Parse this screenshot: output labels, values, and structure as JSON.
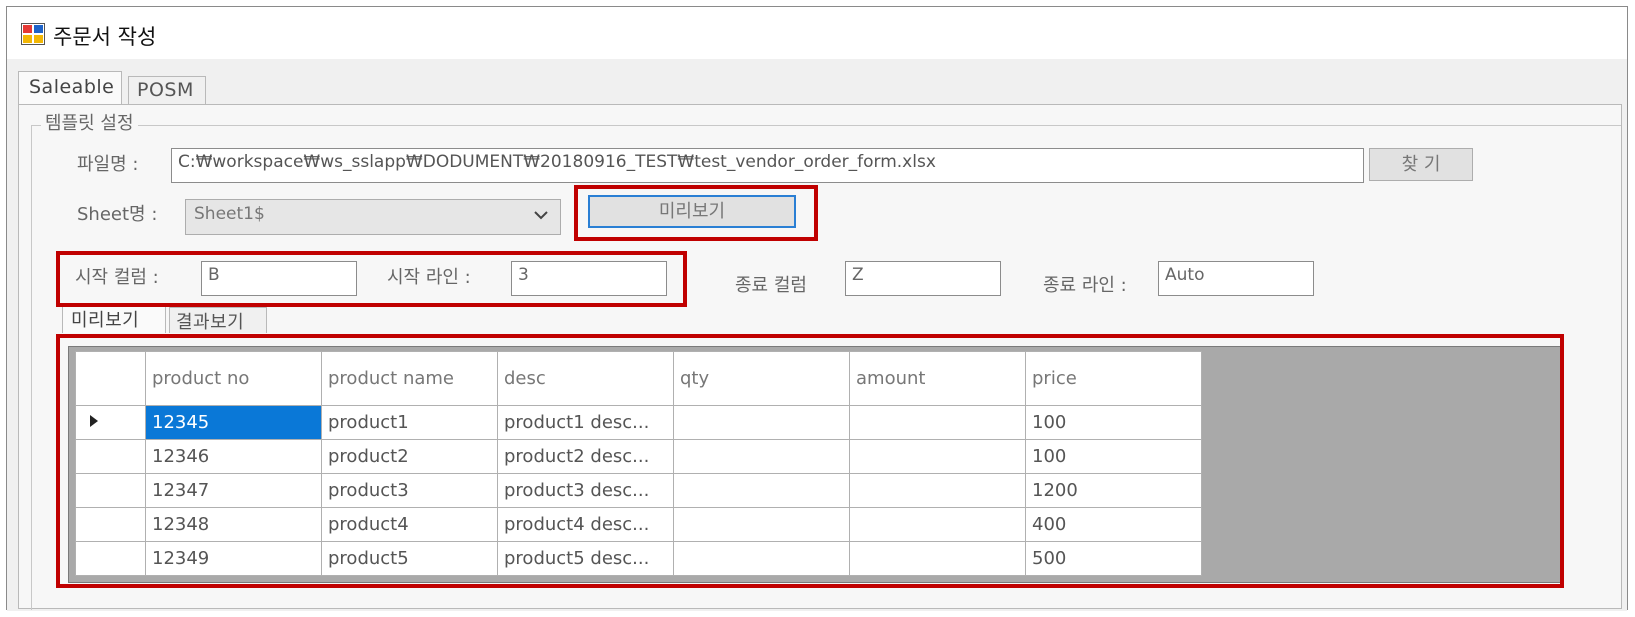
{
  "window": {
    "title": "주문서 작성",
    "icon": "window-form-icon"
  },
  "tabs": [
    {
      "label": "Saleable",
      "active": true
    },
    {
      "label": "POSM",
      "active": false
    }
  ],
  "template_group": {
    "title": "템플릿 설정",
    "file_label": "파일명 :",
    "file_value": "C:₩workspace₩ws_sslapp₩DODUMENT₩20180916_TEST₩test_vendor_order_form.xlsx",
    "find_button": "찾 기",
    "sheet_label": "Sheet명 :",
    "sheet_value": "Sheet1$",
    "preview_button": "미리보기",
    "start_col_label": "시작 컬럼 :",
    "start_col_value": "B",
    "start_line_label": "시작 라인 :",
    "start_line_value": "3",
    "end_col_label": "종료 컬럼",
    "end_col_value": "Z",
    "end_line_label": "종료 라인 :",
    "end_line_value": "Auto"
  },
  "sub_tabs": [
    {
      "label": "미리보기",
      "active": true
    },
    {
      "label": "결과보기",
      "active": false
    }
  ],
  "grid": {
    "columns": [
      "product no",
      "product name",
      "desc",
      "qty",
      "amount",
      "price"
    ],
    "rows": [
      [
        "12345",
        "product1",
        "product1 desc...",
        "",
        "",
        "100"
      ],
      [
        "12346",
        "product2",
        "product2 desc...",
        "",
        "",
        "100"
      ],
      [
        "12347",
        "product3",
        "product3 desc...",
        "",
        "",
        "1200"
      ],
      [
        "12348",
        "product4",
        "product4 desc...",
        "",
        "",
        "400"
      ],
      [
        "12349",
        "product5",
        "product5 desc...",
        "",
        "",
        "500"
      ]
    ],
    "current_row_indicator": "row-pointer-icon",
    "selected_cell_color": "#0a78d7"
  },
  "highlight_color": "#c00000"
}
